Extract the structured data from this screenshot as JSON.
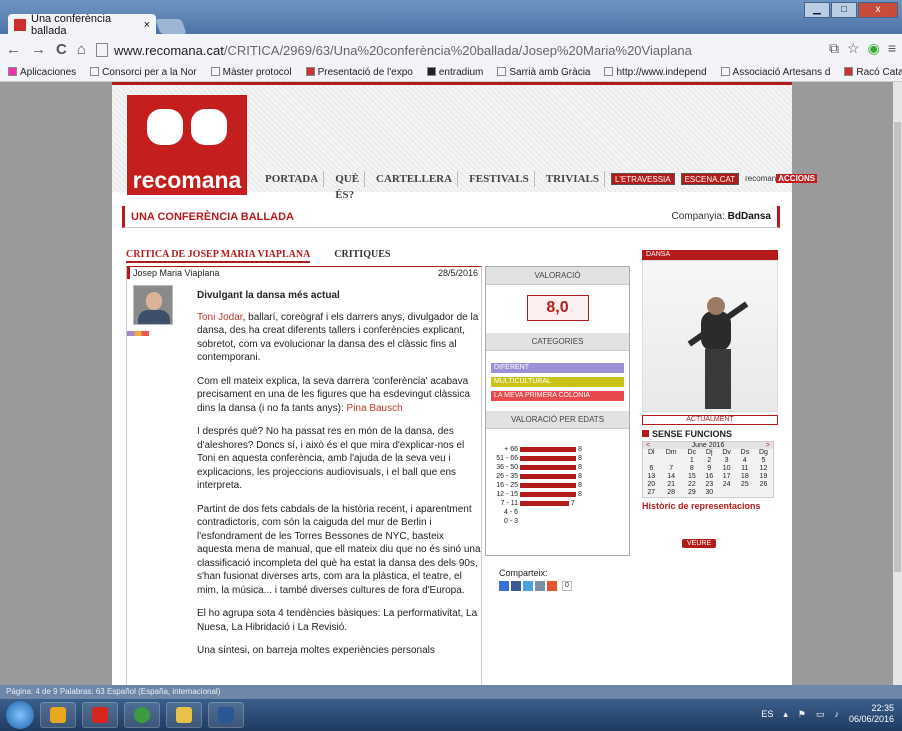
{
  "browser": {
    "tab_title": "Una conferència ballada",
    "tab_close": "×",
    "url_domain": "www.recomana.cat",
    "url_path": "/CRITICA/2969/63/Una%20conferència%20ballada/Josep%20Maria%20Viaplana",
    "nav_back": "←",
    "nav_forward": "→",
    "nav_reload": "C",
    "nav_home": "⌂",
    "window_minimize": "▁",
    "window_maximize": "□",
    "window_close": "x"
  },
  "bookmarks": [
    "Aplicaciones",
    "Consorci per a la Nor",
    "Màster protocol",
    "Presentació de l'expo",
    "entradium",
    "Sarrià amb Gràcia",
    "http://www.independ",
    "Associació Artesans d",
    "Racó Català. El punt d",
    "»"
  ],
  "site": {
    "logo_text": "recomana",
    "nav": [
      "PORTADA",
      "QUÈ ÉS?",
      "CARTELLERA",
      "FESTIVALS",
      "TRIVIALS"
    ],
    "nav_badges": [
      "L'ETRAVESSIA",
      "ESCENA.CAT"
    ],
    "nav_recoman": "recoman",
    "nav_accions": "ACCIONS",
    "page_title": "UNA CONFERÈNCIA BALLADA",
    "company_label": "Companyia:",
    "company_name": "BdDansa"
  },
  "article": {
    "tab_active": "CRITICA DE JOSEP MARIA VIAPLANA",
    "tab_other": "CRITIQUES",
    "author": "Josep Maria Viaplana",
    "date": "28/5/2016",
    "headline": "Divulgant la dansa més actual",
    "p1_link": "Toni Jodar",
    "p1_rest": ", ballarí, coreògraf i els darrers anys, divulgador de la dansa, des ha creat diferents tallers i conferències explicant, sobretot, com va evolucionar la dansa des el clàssic fins al contemporani.",
    "p2_text": "Com ell mateix explica, la seva darrera 'conferència' acabava precisament en una de les figures que ha esdevingut clàssica dins la dansa (i no fa tants anys): ",
    "p2_link": "Pina Bausch",
    "p3": "I després què? No ha passat res en món de la dansa, des d'aleshores? Doncs sí, i això és el que mira d'explicar-nos el Toni en aquesta conferència, amb l'ajuda de la seva veu i explicacions, les projeccions audiovisuals, i el ball que ens interpreta.",
    "p4": "Partint de dos fets cabdals de la història recent, i aparentment contradictoris, com són la caiguda del mur de Berlin i l'esfondrament de les Torres Bessones de NYC, basteix aquesta mena de manual, que ell mateix diu que no és sinó una classificació incompleta del què ha estat la dansa des dels 90s, s'han fusionat diverses arts, com ara la plàstica, el teatre, el mim, la música... i també diverses cultures de fora d'Europa.",
    "p5": "El ho agrupa sota 4 tendències bàsiques: La performativitat, La Nuesa, La Hibridació i La Revisió.",
    "p6": "Una síntesi, on barreja moltes experiències personals"
  },
  "rating": {
    "header": "VALORACIÓ",
    "score": "8,0",
    "categories_header": "CATEGORIES",
    "categories": [
      {
        "label": "DIFERENT",
        "color": "#9d8fd8"
      },
      {
        "label": "MULTICULTURAL",
        "color": "#c9c21a"
      },
      {
        "label": "LA MEVA PRIMERA COLÒNIA",
        "color": "#e74a4a"
      }
    ],
    "age_header": "VALORACIÓ PER EDATS",
    "ages": [
      {
        "label": "+ 66",
        "value": 8
      },
      {
        "label": "51 - 66",
        "value": 8
      },
      {
        "label": "36 - 50",
        "value": 8
      },
      {
        "label": "26 - 35",
        "value": 8
      },
      {
        "label": "16 - 25",
        "value": 8
      },
      {
        "label": "12 - 15",
        "value": 8
      },
      {
        "label": "7 - 11",
        "value": 7
      },
      {
        "label": "4 - 6",
        "value": null
      },
      {
        "label": "0 - 3",
        "value": null
      }
    ],
    "share_label": "Comparteix:",
    "share_count": "0"
  },
  "sidebar": {
    "genre": "DANSA",
    "current": "ACTUALMENT",
    "no_functions": "SENSE FUNCIONS",
    "cal_prev": "<",
    "cal_next": ">",
    "cal_month": "June 2016",
    "cal_days": [
      "Dl",
      "Dm",
      "Dc",
      "Dj",
      "Dv",
      "Ds",
      "Dg"
    ],
    "cal_weeks": [
      [
        "",
        "",
        "1",
        "2",
        "3",
        "4",
        "5"
      ],
      [
        "6",
        "7",
        "8",
        "9",
        "10",
        "11",
        "12"
      ],
      [
        "13",
        "14",
        "15",
        "16",
        "17",
        "18",
        "19"
      ],
      [
        "20",
        "21",
        "22",
        "23",
        "24",
        "25",
        "26"
      ],
      [
        "27",
        "28",
        "29",
        "30",
        "",
        "",
        ""
      ]
    ],
    "history": "Històric de representacions",
    "veure": "VEURE"
  },
  "status_bar": "Página: 4 de 9   Palabras: 63   Español (España, internacional)",
  "taskbar": {
    "lang": "ES",
    "time": "22:35",
    "date": "06/06/2016"
  }
}
